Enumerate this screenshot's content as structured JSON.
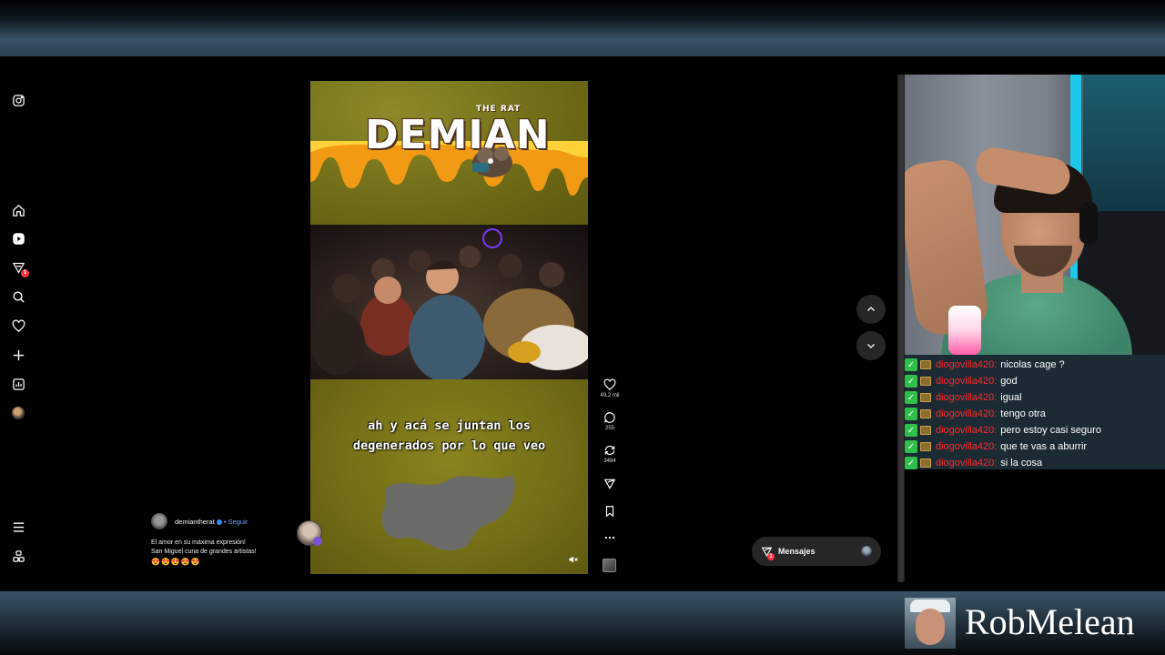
{
  "nav": {
    "items": [
      {
        "name": "instagram-icon"
      },
      {
        "name": "home-icon"
      },
      {
        "name": "reels-icon"
      },
      {
        "name": "explore-icon",
        "badge": "1"
      },
      {
        "name": "search-icon"
      },
      {
        "name": "heart-icon"
      },
      {
        "name": "plus-icon"
      },
      {
        "name": "stats-icon"
      },
      {
        "name": "profile-avatar"
      },
      {
        "name": "menu-icon"
      },
      {
        "name": "threads-icon"
      }
    ]
  },
  "reel": {
    "logo": "DEMIAN",
    "logo_sub": "THE RAT",
    "caption": "ah y acá se juntan los degenerados por lo que veo",
    "likes": "49,2 mil",
    "comments": "255",
    "reposts": "3484"
  },
  "author": {
    "name": "demiantherat",
    "follow": "• Seguir",
    "description_line1": "El amor en su máxima expresión!",
    "description_line2": "San Miguel cuna de grandes artistas!",
    "emojis": "😍😍😍😍😍"
  },
  "messages": {
    "label": "Mensajes",
    "badge": "1"
  },
  "chat": {
    "messages": [
      {
        "user": "diogovilla420:",
        "text": "nicolas cage ?"
      },
      {
        "user": "diogovilla420:",
        "text": "god"
      },
      {
        "user": "diogovilla420:",
        "text": "igual"
      },
      {
        "user": "diogovilla420:",
        "text": "tengo otra"
      },
      {
        "user": "diogovilla420:",
        "text": "pero estoy casi seguro"
      },
      {
        "user": "diogovilla420:",
        "text": "que te vas a aburrir"
      },
      {
        "user": "diogovilla420:",
        "text": "si la cosa"
      }
    ]
  },
  "streamer": {
    "name": "RobMelean"
  },
  "colors": {
    "chat_username": "#ff2a2a",
    "badge_red": "#ff3040",
    "reel_yellow": "#7a7418",
    "ui_dark": "#262626"
  }
}
